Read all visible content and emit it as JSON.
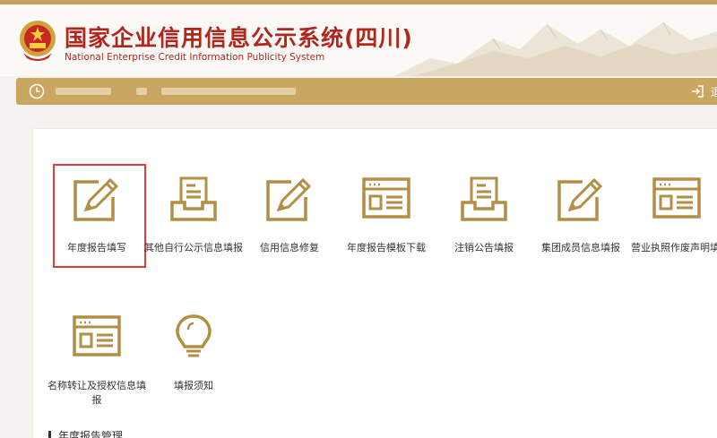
{
  "header": {
    "title": "国家企业信用信息公示系统(四川)",
    "subtitle": "National Enterprise Credit Information Publicity System"
  },
  "info_bar": {
    "exit_label": "退"
  },
  "tiles_row1": [
    {
      "name": "annual-report-fill",
      "label": "年度报告填写",
      "icon": "pencil-edit-icon"
    },
    {
      "name": "other-self-disclosure",
      "label": "其他自行公示信息填报",
      "icon": "inbox-tray-icon"
    },
    {
      "name": "credit-repair",
      "label": "信用信息修复",
      "icon": "pencil-edit-icon"
    },
    {
      "name": "annual-report-template",
      "label": "年度报告模板下载",
      "icon": "form-template-icon"
    },
    {
      "name": "deregistration-notice",
      "label": "注销公告填报",
      "icon": "inbox-tray-icon"
    },
    {
      "name": "group-member-info",
      "label": "集团成员信息填报",
      "icon": "pencil-edit-icon"
    },
    {
      "name": "license-void-statement",
      "label": "营业执照作废声明填报",
      "icon": "form-template-icon"
    }
  ],
  "tiles_row2": [
    {
      "name": "name-transfer-authorization",
      "label": "名称转让及授权信息填报",
      "icon": "form-template-icon"
    },
    {
      "name": "filing-instructions",
      "label": "填报须知",
      "icon": "lightbulb-icon"
    }
  ],
  "section": {
    "title": "年度报告管理"
  },
  "colors": {
    "gold": "#c9a761",
    "icon_gold": "#b38e45",
    "title_red": "#b3261e",
    "selected_border": "#e03a3a"
  }
}
